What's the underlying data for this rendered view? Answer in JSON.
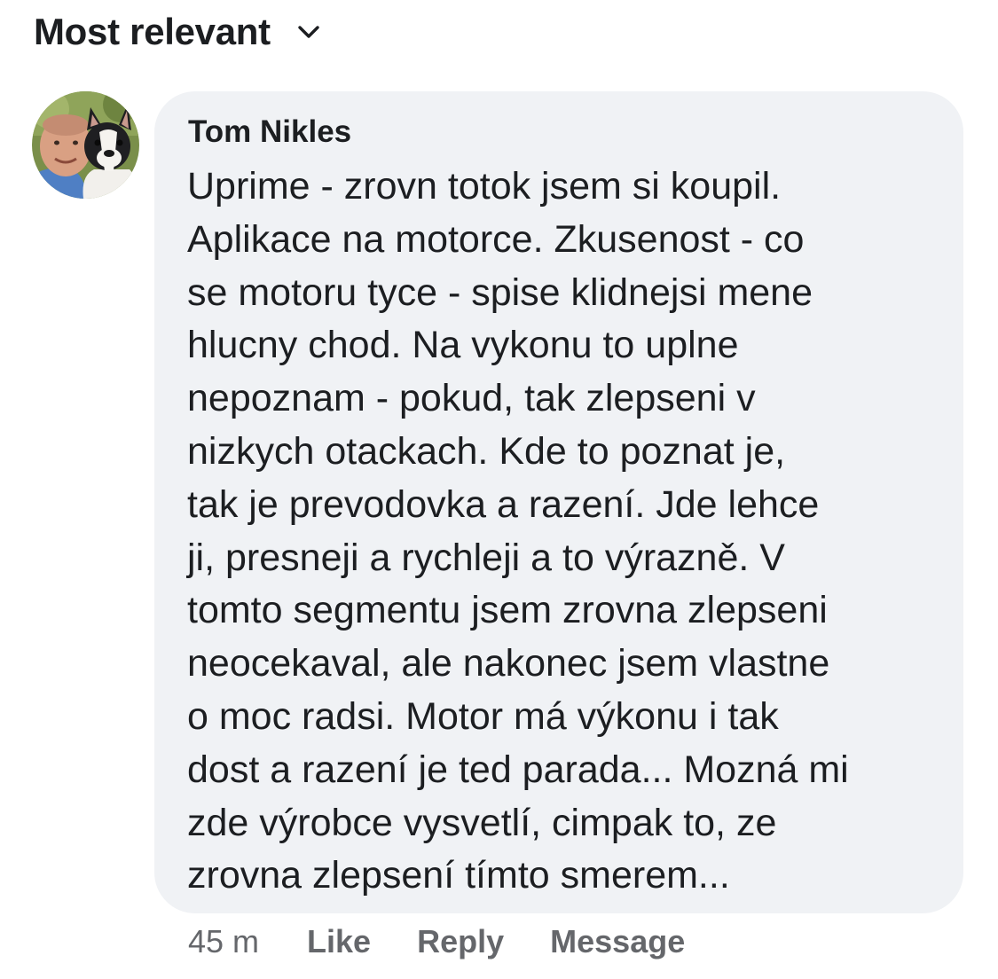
{
  "sort": {
    "label": "Most relevant",
    "icon": "chevron-down-icon"
  },
  "comment": {
    "author": "Tom Nikles",
    "lines": [
      "Uprime - zrovn totok jsem si koupil.",
      "Aplikace na motorce. Zkusenost - co",
      "se motoru tyce - spise klidnejsi mene",
      "hlucny chod. Na vykonu to uplne",
      "nepoznam - pokud, tak zlepseni v",
      "nizkych otackach. Kde to poznat je,",
      "tak je prevodovka a razení. Jde lehce",
      "ji, presneji a rychleji a to výrazně. V",
      "tomto segmentu jsem zrovna zlepseni",
      "neocekaval, ale nakonec jsem vlastne",
      "o moc radsi. Motor má výkonu i tak",
      "dost a razení je ted parada... Mozná mi",
      "zde výrobce vysvetlí, cimpak to, ze",
      "zrovna zlepsení tímto smerem..."
    ],
    "timestamp": "45 m",
    "actions": {
      "like": "Like",
      "reply": "Reply",
      "message": "Message"
    },
    "colors": {
      "bubble": "#f0f2f5",
      "text": "#1c1e21",
      "meta": "#65676b"
    }
  }
}
